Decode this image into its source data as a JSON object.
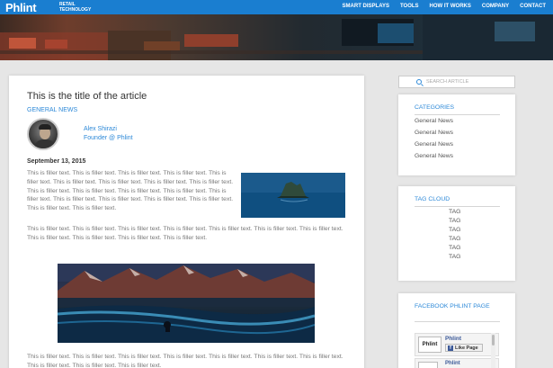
{
  "header": {
    "logo": "Phlint",
    "logo_sub_line1": "RETAIL",
    "logo_sub_line2": "TECHNOLOGY",
    "nav": [
      "SMART DISPLAYS",
      "TOOLS",
      "HOW IT WORKS",
      "COMPANY",
      "CONTACT"
    ]
  },
  "article": {
    "title": "This is the title of the article",
    "category": "GENERAL NEWS",
    "author_name": "Alex Shirazi",
    "author_role": "Founder @ Phlint",
    "date": "September 13, 2015",
    "paragraph1": "This is filler text. This is filler text. This is filler text. This is filler text. This is filler text. This is filler text. This is filler text. This is filler text. This is filler text. This is filler text. This is filler text. This is filler text. This is filler text. This is filler text. This is filler text. This is filler text. This is filler text. This is filler text. This is filler text. This is filler text.",
    "paragraph2": "This is filler text. This is filler text. This is filler text. This is filler text. This is filler text. This is filler text. This is filler text. This is filler text. This is filler text. This is filler text. This is filler text.",
    "paragraph3": "This is filler text. This is filler text. This is filler text. This is filler text. This is filler text. This is filler text. This is filler text. This is filler text. This is filler text. This is filler text."
  },
  "sidebar": {
    "search_placeholder": "SEARCH ARTICLE",
    "categories_title": "CATEGORIES",
    "categories": [
      "General News",
      "General News",
      "General News",
      "General News"
    ],
    "tagcloud_title": "TAG CLOUD",
    "tags": [
      "TAG",
      "TAG",
      "TAG",
      "TAG",
      "TAG",
      "TAG"
    ],
    "facebook_title": "FACEBOOK PHLINT PAGE",
    "facebook_page_name": "Phlint",
    "facebook_like_label": "Like Page",
    "facebook_logo_text": "Phlint",
    "facebook_page_name_2": "Phlint"
  },
  "colors": {
    "nav_bg": "#1a7ed0",
    "accent": "#2d89d8",
    "page_bg": "#e6e6e6"
  }
}
